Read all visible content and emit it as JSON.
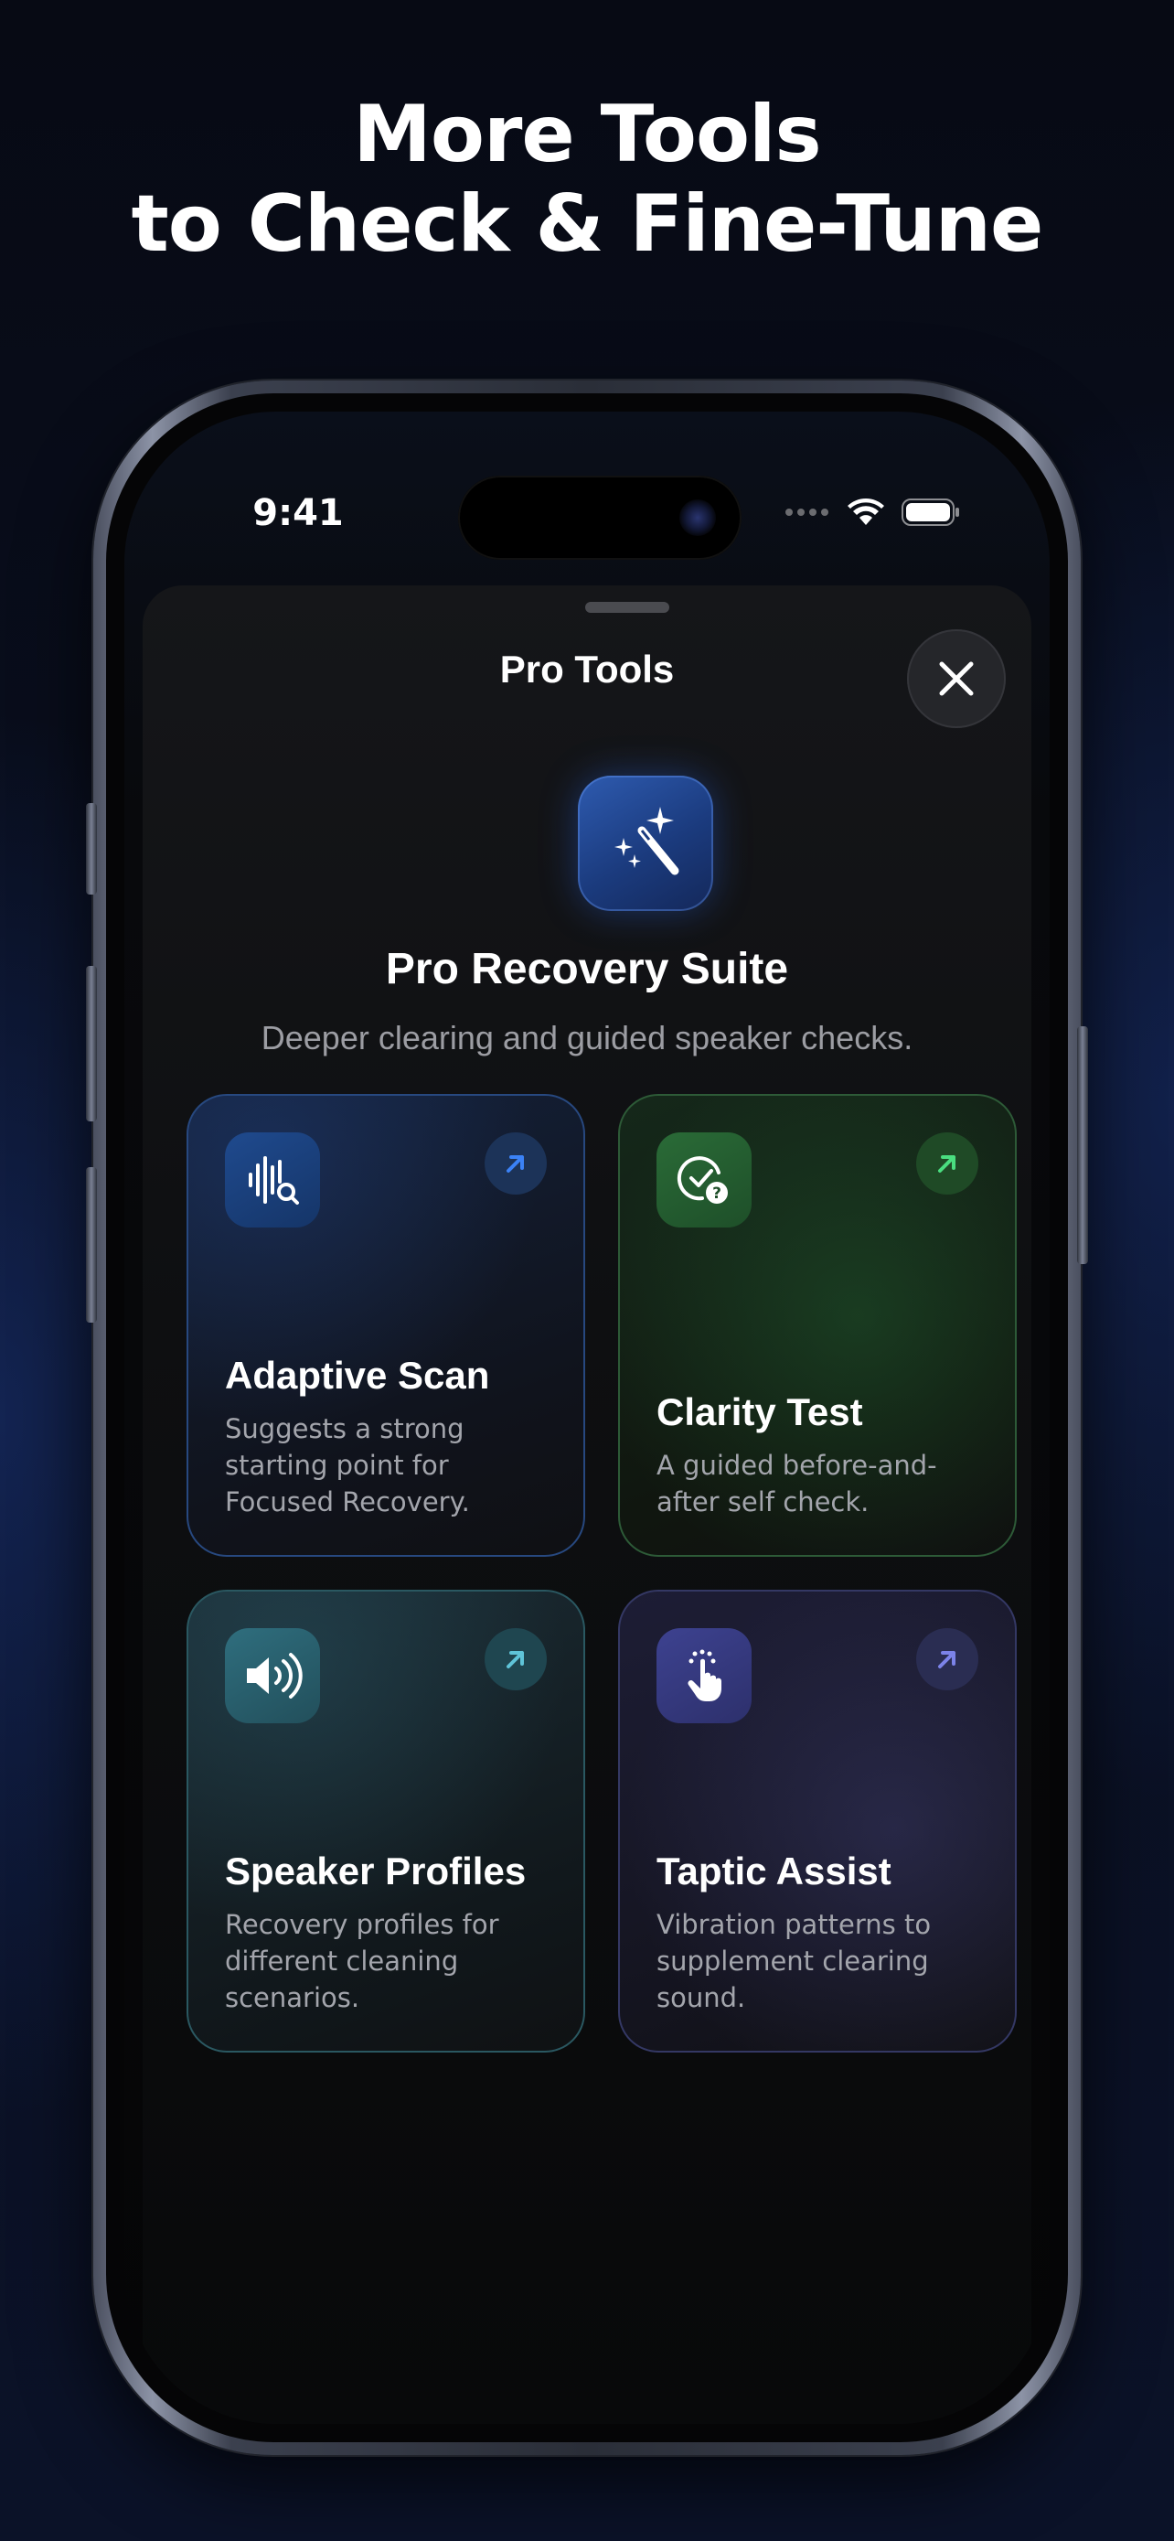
{
  "headline": {
    "line1": "More Tools",
    "line2": "to Check & Fine-Tune"
  },
  "status_bar": {
    "time": "9:41"
  },
  "sheet": {
    "title": "Pro Tools",
    "close_icon": "close-icon"
  },
  "hero": {
    "icon": "magic-wand-sparkles-icon",
    "title": "Pro Recovery Suite",
    "subtitle": "Deeper clearing and guided speaker checks."
  },
  "cards": [
    {
      "title": "Adaptive Scan",
      "description": "Suggests a strong starting point for Focused Recovery.",
      "icon": "waveform-search-icon",
      "accent": "#3b82f6"
    },
    {
      "title": "Clarity Test",
      "description": "A guided before-and-after self check.",
      "icon": "checkmark-question-icon",
      "accent": "#4ade80"
    },
    {
      "title": "Speaker Profiles",
      "description": "Recovery profiles for different cleaning scenarios.",
      "icon": "speaker-wave-icon",
      "accent": "#5fc4d8"
    },
    {
      "title": "Taptic Assist",
      "description": "Vibration patterns to supplement clearing sound.",
      "icon": "hand-tap-icon",
      "accent": "#7c83e8"
    }
  ],
  "colors": {
    "background": "#0a1022",
    "sheet": "#111214",
    "text_secondary": "#9c9da3"
  }
}
